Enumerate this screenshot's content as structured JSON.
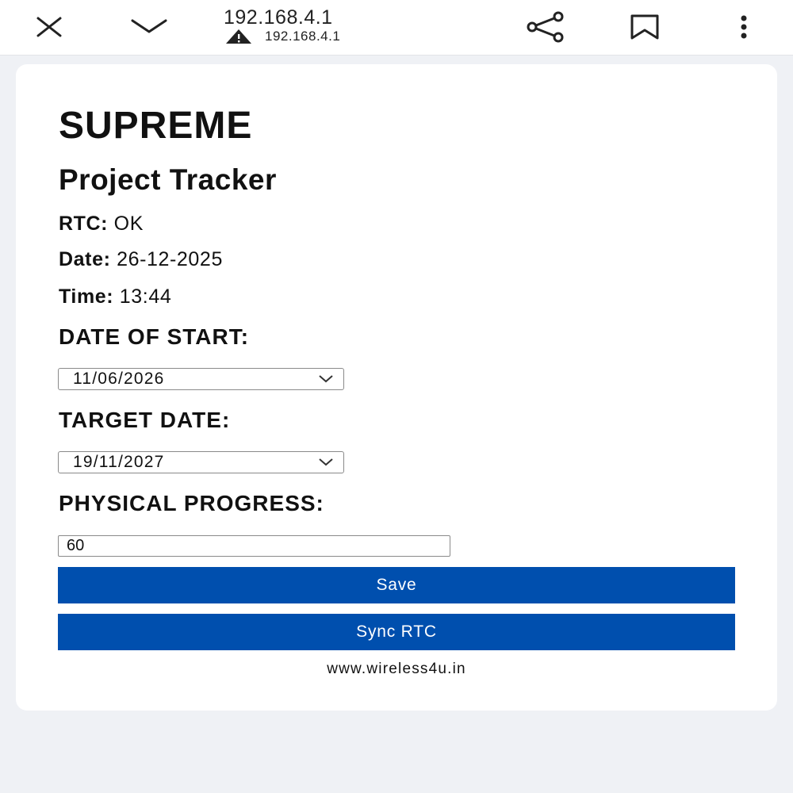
{
  "browser": {
    "url_title": "192.168.4.1",
    "url_subtitle": "192.168.4.1",
    "icons": [
      "close-icon",
      "chevron-down-icon",
      "warning-icon",
      "share-icon",
      "bookmark-icon",
      "more-vert-icon"
    ]
  },
  "page": {
    "title": "SUPREME",
    "subtitle": "Project Tracker",
    "rtc": {
      "label": "RTC:",
      "value": "OK"
    },
    "date": {
      "label": "Date:",
      "value": "26-12-2025"
    },
    "time": {
      "label": "Time:",
      "value": "13:44"
    },
    "start": {
      "label": "DATE OF START:",
      "value": "11/06/2026"
    },
    "target": {
      "label": "TARGET DATE:",
      "value": "19/11/2027"
    },
    "progress": {
      "label": "PHYSICAL PROGRESS:",
      "value": "60"
    },
    "save_label": "Save",
    "sync_label": "Sync RTC",
    "footer": "www.wireless4u.in"
  },
  "colors": {
    "accent": "#004fae",
    "page_bg": "#eff1f5",
    "card_bg": "#ffffff"
  }
}
